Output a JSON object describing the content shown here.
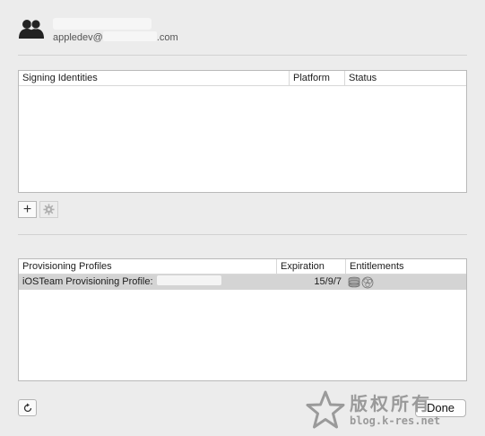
{
  "account": {
    "name": "",
    "email_prefix": "appledev@",
    "email_suffix": ".com"
  },
  "signing_identities": {
    "columns": [
      "Signing Identities",
      "Platform",
      "Status"
    ],
    "rows": []
  },
  "identity_toolbar": {
    "add_label": "+",
    "gear_icon": "gear-icon"
  },
  "provisioning_profiles": {
    "columns": [
      "Provisioning Profiles",
      "Expiration",
      "Entitlements"
    ],
    "rows": [
      {
        "name": "iOSTeam Provisioning Profile:",
        "expiration": "15/9/7",
        "entitlements_icon": "entitlements-icon"
      }
    ]
  },
  "footer": {
    "refresh_icon": "refresh-icon",
    "done_label": "Done"
  },
  "watermark": {
    "text": "版权所有",
    "url": "blog.k-res.net"
  }
}
